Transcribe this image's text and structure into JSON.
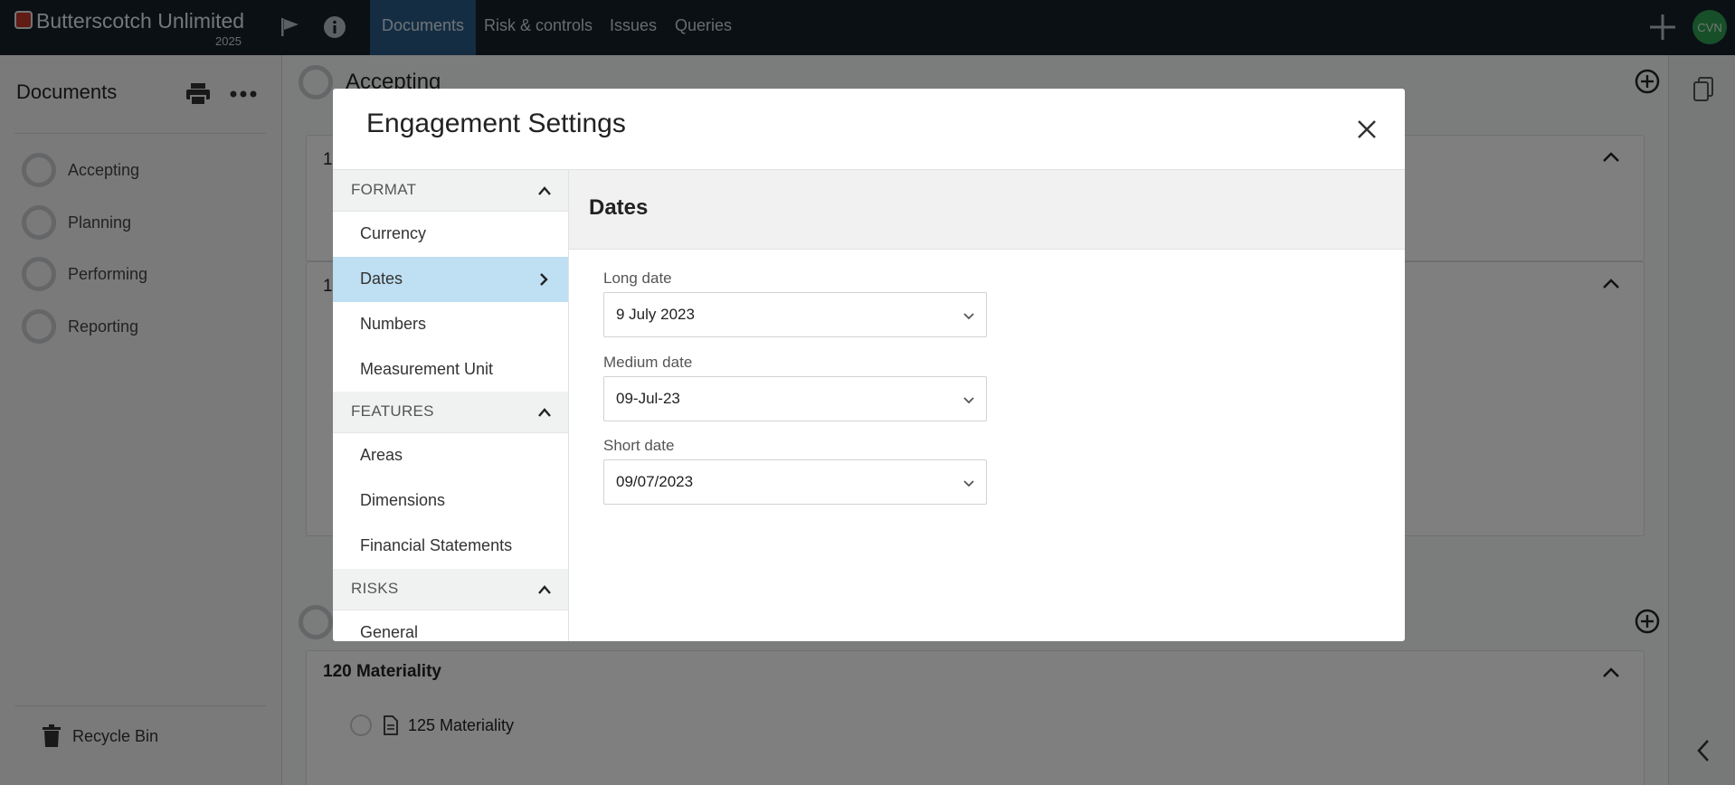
{
  "app": {
    "name": "Butterscotch Unlimited",
    "year": "2025"
  },
  "nav": {
    "tabs": [
      {
        "label": "Documents"
      },
      {
        "label": "Risk & controls"
      },
      {
        "label": "Issues"
      },
      {
        "label": "Queries"
      }
    ],
    "active_tab": "Documents",
    "user_initials": "CVN",
    "icons": [
      "flag-icon",
      "info-icon",
      "plus-icon"
    ]
  },
  "sidebar": {
    "title": "Documents",
    "items": [
      {
        "label": "Accepting"
      },
      {
        "label": "Planning"
      },
      {
        "label": "Performing"
      },
      {
        "label": "Reporting"
      }
    ],
    "recycle_label": "Recycle Bin"
  },
  "main": {
    "phase_title": "Accepting",
    "card_number_1": "1",
    "card_number_2": "1",
    "materiality_title": "120 Materiality",
    "materiality_doc": "125 Materiality"
  },
  "modal": {
    "title": "Engagement Settings",
    "groups": [
      {
        "label": "FORMAT",
        "items": [
          "Currency",
          "Dates",
          "Numbers",
          "Measurement Unit"
        ]
      },
      {
        "label": "FEATURES",
        "items": [
          "Areas",
          "Dimensions",
          "Financial Statements"
        ]
      },
      {
        "label": "RISKS",
        "items": [
          "General"
        ]
      }
    ],
    "selected_item": "Dates",
    "panel_title": "Dates",
    "fields": {
      "long": {
        "label": "Long date",
        "value": "9 July 2023"
      },
      "medium": {
        "label": "Medium date",
        "value": "09-Jul-23"
      },
      "short": {
        "label": "Short date",
        "value": "09/07/2023"
      }
    }
  },
  "colors": {
    "topbar": "#17202a",
    "active_tab": "#2b5b84",
    "avatar": "#2f9e52",
    "selected_nav": "#bfdff2",
    "logo": "#c0392b"
  }
}
